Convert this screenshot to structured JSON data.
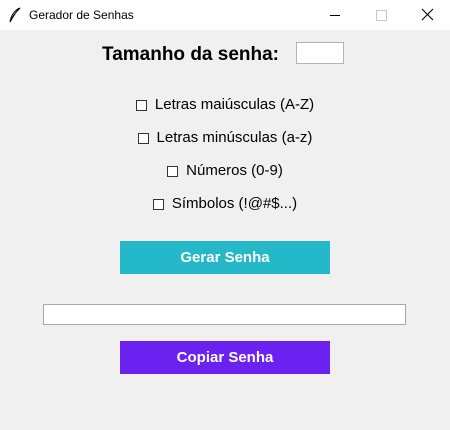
{
  "window": {
    "title": "Gerador de Senhas"
  },
  "form": {
    "size_label": "Tamanho da senha:",
    "size_value": ""
  },
  "options": [
    {
      "label": "Letras maiúsculas (A-Z)",
      "checked": false
    },
    {
      "label": "Letras minúsculas (a-z)",
      "checked": false
    },
    {
      "label": "Números (0-9)",
      "checked": false
    },
    {
      "label": "Símbolos (!@#$...)",
      "checked": false
    }
  ],
  "buttons": {
    "generate_label": "Gerar Senha",
    "copy_label": "Copiar Senha"
  },
  "output": {
    "value": ""
  },
  "colors": {
    "generate_button": "#25b8c9",
    "copy_button": "#6b22f1",
    "background": "#f0f0f0"
  }
}
